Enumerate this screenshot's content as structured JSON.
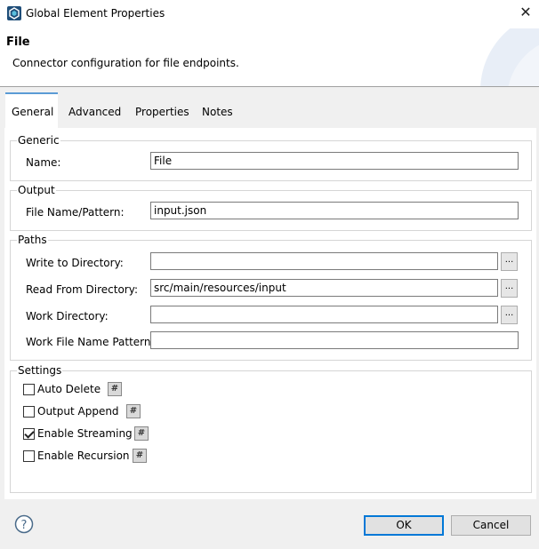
{
  "window": {
    "title": "Global Element Properties",
    "close_glyph": "✕",
    "app_icon": "mule-app-icon"
  },
  "header": {
    "title": "File",
    "subtitle": "Connector configuration for file endpoints."
  },
  "tabs": [
    {
      "label": "General",
      "active": true
    },
    {
      "label": "Advanced",
      "active": false
    },
    {
      "label": "Properties",
      "active": false
    },
    {
      "label": "Notes",
      "active": false
    }
  ],
  "groups": {
    "generic": {
      "label": "Generic",
      "name_label": "Name:",
      "name_value": "File"
    },
    "output": {
      "label": "Output",
      "pattern_label": "File Name/Pattern:",
      "pattern_value": "input.json"
    },
    "paths": {
      "label": "Paths",
      "write_label": "Write to Directory:",
      "write_value": "",
      "read_label": "Read From Directory:",
      "read_value": "src/main/resources/input",
      "work_label": "Work Directory:",
      "work_value": "",
      "work_pattern_label": "Work File Name Pattern:",
      "work_pattern_value": "",
      "browse_label": "..."
    },
    "settings": {
      "label": "Settings",
      "hash_label": "#",
      "items": [
        {
          "label": "Auto Delete",
          "checked": false
        },
        {
          "label": "Output Append",
          "checked": false
        },
        {
          "label": "Enable Streaming",
          "checked": true
        },
        {
          "label": "Enable Recursion",
          "checked": false
        }
      ]
    }
  },
  "footer": {
    "help_glyph": "?",
    "ok_label": "OK",
    "cancel_label": "Cancel"
  },
  "colors": {
    "accent": "#0078d7",
    "tab_accent": "#5b9bd5",
    "background": "#f0f0f0"
  }
}
